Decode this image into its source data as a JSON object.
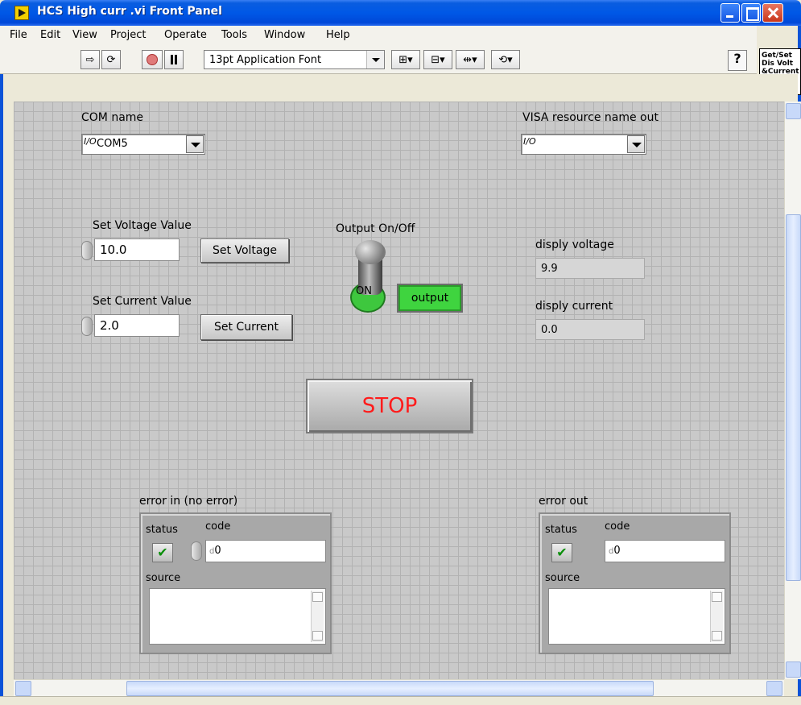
{
  "window": {
    "title": "HCS High curr .vi Front Panel"
  },
  "menu": [
    {
      "label": "File"
    },
    {
      "label": "Edit"
    },
    {
      "label": "View"
    },
    {
      "label": "Project"
    },
    {
      "label": "Operate"
    },
    {
      "label": "Tools"
    },
    {
      "label": "Window"
    },
    {
      "label": "Help"
    }
  ],
  "toolbar": {
    "font": "13pt Application Font",
    "help": "?",
    "icon_text": "Get/Set Dis Volt &Current"
  },
  "panel": {
    "com_name": {
      "label": "COM name",
      "value": "COM5",
      "io": "I/O"
    },
    "visa_out": {
      "label": "VISA resource name out",
      "value": "",
      "io": "I/O"
    },
    "set_voltage_value": {
      "label": "Set Voltage Value",
      "value": "10.0"
    },
    "set_voltage_button": "Set Voltage",
    "set_current_value": {
      "label": "Set Current Value",
      "value": "2.0"
    },
    "set_current_button": "Set Current",
    "output_onoff": {
      "label": "Output On/Off",
      "state_text": "ON",
      "led_text": "output",
      "led_color": "#3fd43f"
    },
    "disp_voltage": {
      "label": "disply voltage",
      "value": "9.9"
    },
    "disp_current": {
      "label": "disply current",
      "value": "0.0"
    },
    "stop": {
      "label": "STOP",
      "color": "#ff1b1b"
    },
    "error_in": {
      "label": "error in (no error)",
      "status_label": "status",
      "code_label": "code",
      "code_value": "0",
      "source_label": "source",
      "status_mark": "✔"
    },
    "error_out": {
      "label": "error out",
      "status_label": "status",
      "code_label": "code",
      "code_value": "0",
      "source_label": "source",
      "status_mark": "✔"
    }
  }
}
